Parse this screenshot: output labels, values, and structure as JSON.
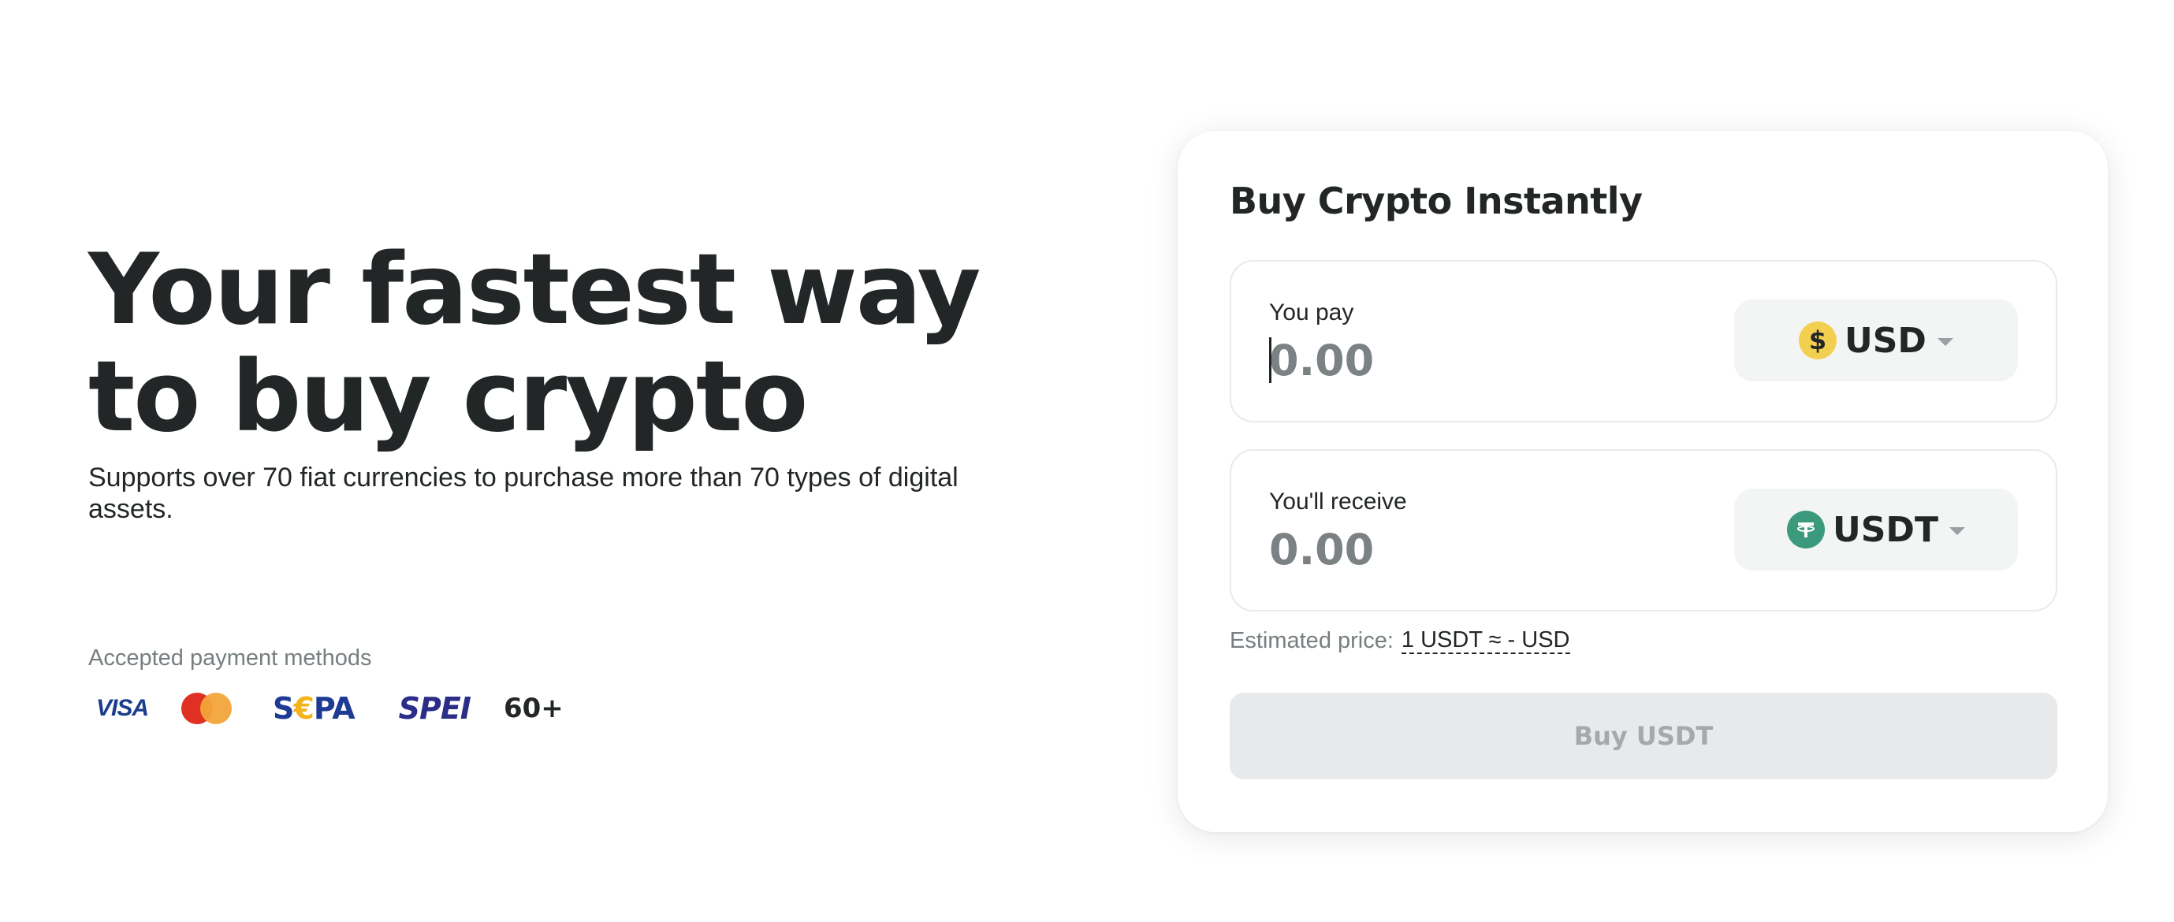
{
  "hero": {
    "title_line1": "Your fastest way",
    "title_line2": "to buy crypto",
    "subtitle": "Supports over 70 fiat currencies to purchase more than 70 types of digital assets."
  },
  "payments": {
    "label": "Accepted payment methods",
    "visa": "VISA",
    "sepa_s": "S",
    "sepa_euro": "€",
    "sepa_pa": "PA",
    "spei": "SPEI",
    "more": "60+"
  },
  "widget": {
    "title": "Buy Crypto Instantly",
    "pay": {
      "label": "You pay",
      "placeholder": "0.00",
      "currency": "USD",
      "currency_icon": "dollar-coin-icon",
      "icon_glyph": "$",
      "icon_color": "#f3cf4f"
    },
    "receive": {
      "label": "You'll receive",
      "placeholder": "0.00",
      "currency": "USDT",
      "currency_icon": "tether-icon",
      "icon_color": "#3c9a7c"
    },
    "estimate_label": "Estimated price:",
    "estimate_value": "1 USDT ≈ - USD",
    "buy_button": "Buy USDT"
  }
}
